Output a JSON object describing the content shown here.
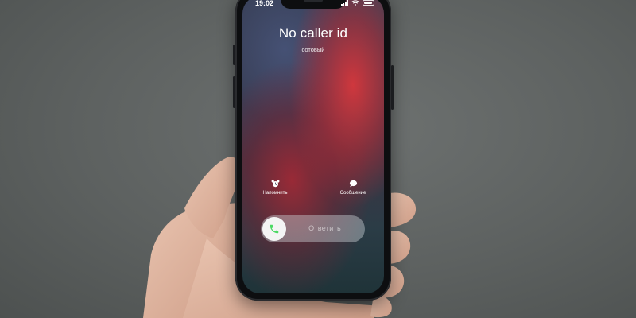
{
  "status_bar": {
    "time": "19:02"
  },
  "call": {
    "caller": "No caller id",
    "type": "сотовый"
  },
  "actions": {
    "remind": {
      "label": "Напомнить",
      "icon": "alarm-clock-icon"
    },
    "message": {
      "label": "Сообщение",
      "icon": "message-bubble-icon"
    }
  },
  "answer_slider": {
    "label": "Ответить",
    "icon": "phone-icon",
    "accent": "#4cd964"
  },
  "colors": {
    "wallpaper_red": "#d7373c",
    "wallpaper_blue": "#465276",
    "background_gray": "#5d6160"
  }
}
